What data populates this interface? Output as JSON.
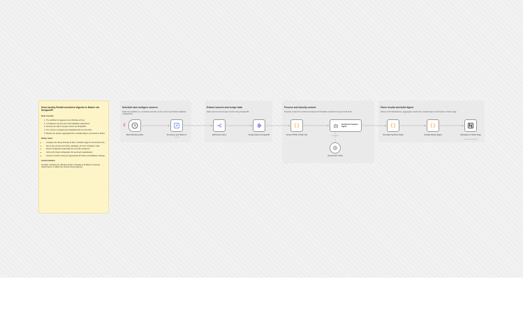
{
  "note": {
    "title": "Send weekly Reddit sentiment digests to Notion via ScrapeAPI",
    "how_heading": "How it works",
    "how_items": [
      "The workflow is triggered every Monday at 8 am.",
      "It configures sources and notion database parameters.",
      "Sources are split to scrape content via ScrapeAPI.",
      "The content is prepared and classified with an LLM chain.",
      "Results are parsed, aggregated into a weekly digest, and saved to Notion."
    ],
    "setup_heading": "Setup steps",
    "setup_items": [
      "Configure the 'Every Monday at 8am' schedule trigger to the desired time.",
      "Set up the sources and notion_database_id in the 'Configure' node.",
      "Ensure ScrapeAPI credentials are correctly configured.",
      "Verify LLM Chain configuration for sentiment classification.",
      "Connect to Notion using the appropriate API token and database settings."
    ],
    "custom_heading": "Customization",
    "custom_text": "Consider modifying the 'Monday at 8am' schedule to fit different reporting requirements, or adjust the sources being analyzed."
  },
  "sections": [
    {
      "title": "Schedule and configure sources",
      "desc": "Starts the workflow on a schedule and sets up the sources and Notion database configuration."
    },
    {
      "title": "Extract sources and scrape data",
      "desc": "Splits sources and scrapes content using ScrapeAPI."
    },
    {
      "title": "Process and classify content",
      "desc": "Prepares content for sentiment analysis and classifies sentiment using an LLM chain."
    },
    {
      "title": "Parse results and build digest",
      "desc": "Parses LLM classifications, aggregates results into a weekly digest, and creates a Notion page."
    }
  ],
  "nodes": {
    "trigger": {
      "label": "When Monday at 8am"
    },
    "set_source": {
      "label": "Set Source and Notion ID",
      "sub": "manual"
    },
    "split": {
      "label": "Split Source Items"
    },
    "scrape": {
      "label": "Scrape Data via ScrapeAPI"
    },
    "convert": {
      "label": "Convert HTML to Plain Text"
    },
    "agent": {
      "label": "Sentiment Analysis Agent"
    },
    "openai": {
      "label": "OpenAI GPT-4 Mini"
    },
    "normalize": {
      "label": "Normalize Sentiment Data"
    },
    "compile": {
      "label": "Compile Weekly Digest"
    },
    "notion": {
      "label": "Add Digest to Notion Page",
      "sub": "create: databasePage"
    }
  },
  "connection_labels": {
    "agent_model": "Chat Model"
  },
  "colors": {
    "note_bg": "#fdf5c8",
    "trigger_accent": "#ff6d5a",
    "set_icon": "#5b7cf0",
    "split_icon": "#8b5cf6",
    "scrape_icon": "#4f46e5",
    "code_icon": "#ff9b29"
  },
  "icons": {
    "trigger": "clock-icon",
    "set_source": "pencil-icon",
    "split": "split-icon",
    "scrape": "scrapeapi-icon",
    "convert": "code-braces-icon",
    "agent": "robot-icon",
    "openai": "openai-icon",
    "normalize": "code-braces-icon",
    "compile": "code-braces-icon",
    "notion": "notion-icon"
  }
}
